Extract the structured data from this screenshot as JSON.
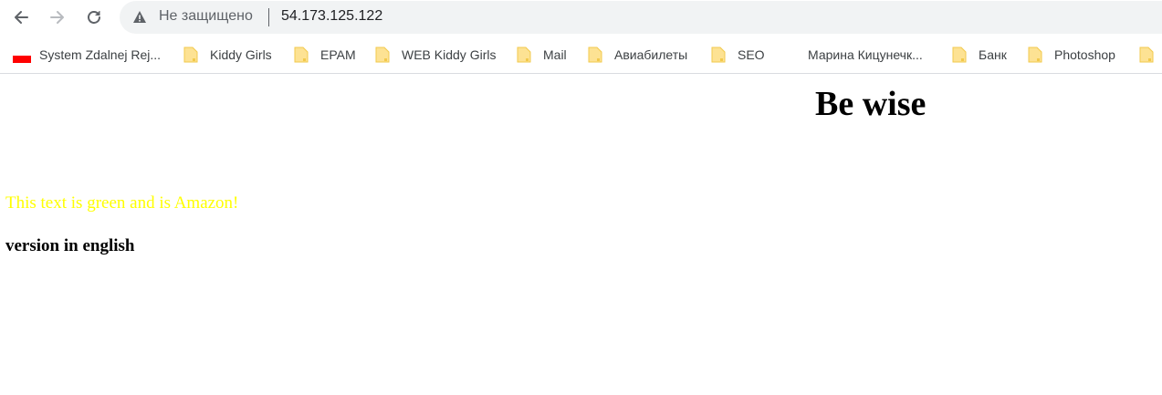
{
  "browser": {
    "security_label": "Не защищено",
    "url": "54.173.125.122"
  },
  "bookmarks": [
    {
      "label": "System Zdalnej Rej...",
      "icon": "flag-icon"
    },
    {
      "label": "Kiddy Girls",
      "icon": "folder-icon"
    },
    {
      "label": "EPAM",
      "icon": "folder-icon"
    },
    {
      "label": "WEB Kiddy Girls",
      "icon": "folder-icon"
    },
    {
      "label": "Mail",
      "icon": "folder-icon"
    },
    {
      "label": "Авиабилеты",
      "icon": "folder-icon"
    },
    {
      "label": "SEO",
      "icon": "folder-icon"
    },
    {
      "label": "Марина Кицунечк...",
      "icon": "none"
    },
    {
      "label": "Банк",
      "icon": "folder-icon"
    },
    {
      "label": "Photoshop",
      "icon": "folder-icon"
    },
    {
      "label": "",
      "icon": "folder-icon"
    }
  ],
  "page": {
    "title": "Be wise",
    "colored_text": "This text is green and is Amazon!",
    "colored_text_color": "#ffff00",
    "version_text": "version in english"
  },
  "colors": {
    "folder_fill": "#fde293",
    "folder_stroke": "#f2c94c",
    "flag": "#ff0000"
  }
}
